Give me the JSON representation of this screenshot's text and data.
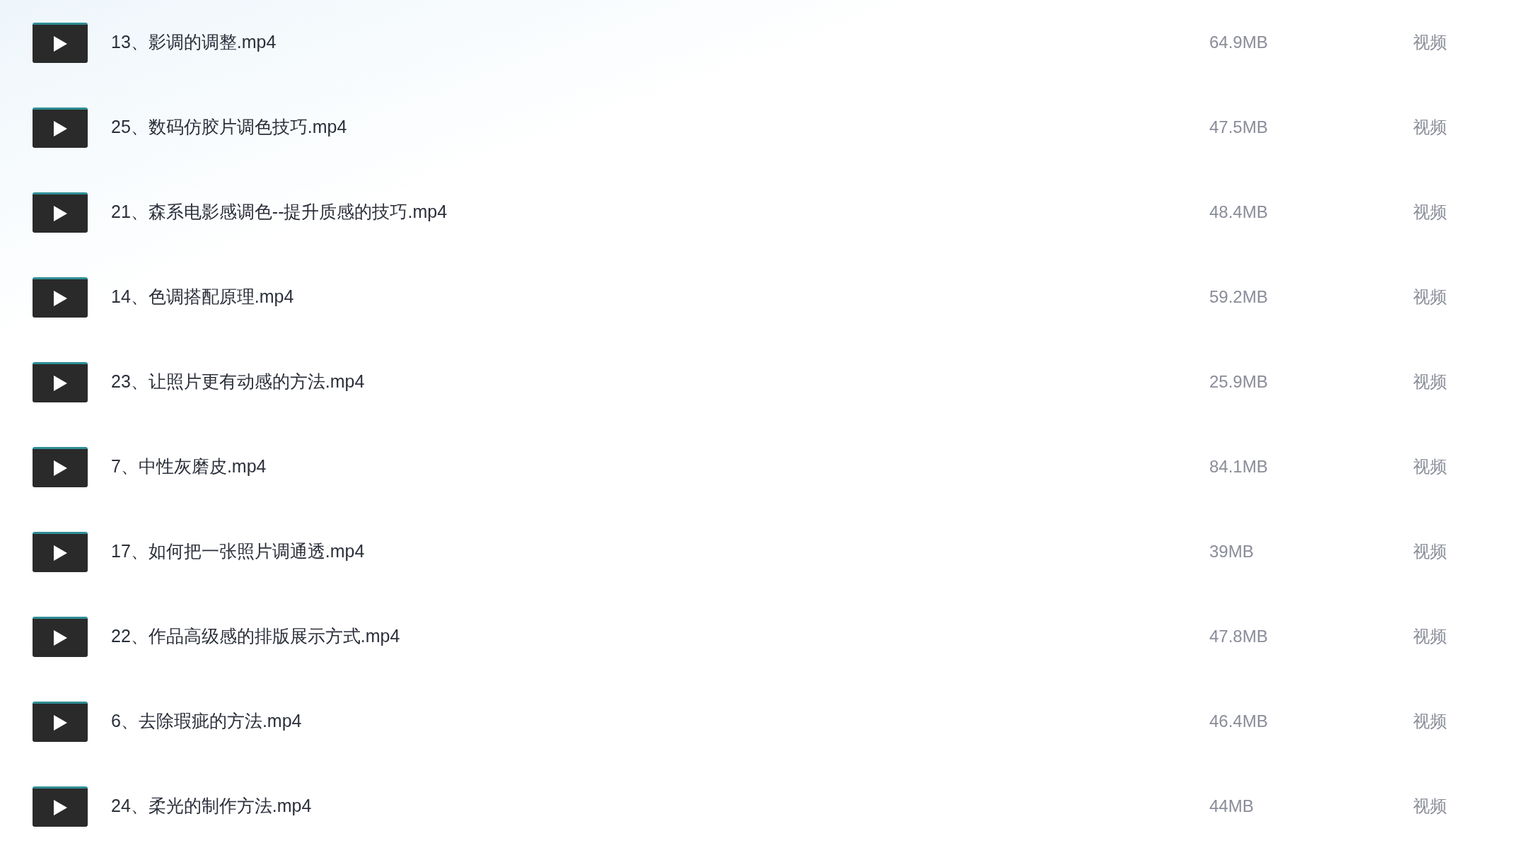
{
  "files": [
    {
      "name": "13、影调的调整.mp4",
      "size": "64.9MB",
      "type": "视频"
    },
    {
      "name": "25、数码仿胶片调色技巧.mp4",
      "size": "47.5MB",
      "type": "视频"
    },
    {
      "name": "21、森系电影感调色--提升质感的技巧.mp4",
      "size": "48.4MB",
      "type": "视频"
    },
    {
      "name": "14、色调搭配原理.mp4",
      "size": "59.2MB",
      "type": "视频"
    },
    {
      "name": "23、让照片更有动感的方法.mp4",
      "size": "25.9MB",
      "type": "视频"
    },
    {
      "name": "7、中性灰磨皮.mp4",
      "size": "84.1MB",
      "type": "视频"
    },
    {
      "name": "17、如何把一张照片调通透.mp4",
      "size": "39MB",
      "type": "视频"
    },
    {
      "name": "22、作品高级感的排版展示方式.mp4",
      "size": "47.8MB",
      "type": "视频"
    },
    {
      "name": "6、去除瑕疵的方法.mp4",
      "size": "46.4MB",
      "type": "视频"
    },
    {
      "name": "24、柔光的制作方法.mp4",
      "size": "44MB",
      "type": "视频"
    }
  ]
}
